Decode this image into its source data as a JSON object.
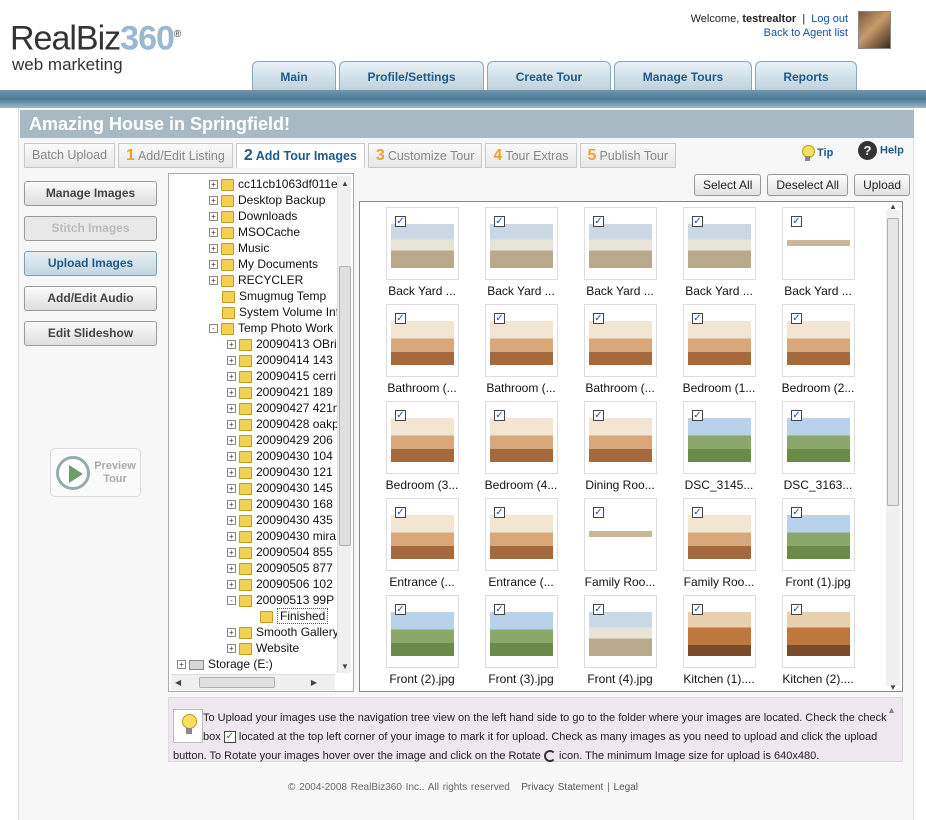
{
  "brand": {
    "name_main": "RealBiz",
    "name_num": "360",
    "reg": "®",
    "tagline": "web marketing"
  },
  "user": {
    "welcome_prefix": "Welcome, ",
    "username": "testrealtor",
    "separator": "|",
    "logout": "Log out",
    "back_to_agent_list": "Back to Agent list"
  },
  "nav_tabs": [
    "Main",
    "Profile/Settings",
    "Create Tour",
    "Manage Tours",
    "Reports"
  ],
  "tour_title": "Amazing House in Springfield!",
  "steps": [
    {
      "num": "",
      "label": "Batch Upload",
      "active": false
    },
    {
      "num": "1",
      "label": "Add/Edit Listing",
      "active": false
    },
    {
      "num": "2",
      "label": "Add Tour Images",
      "active": true
    },
    {
      "num": "3",
      "label": "Customize Tour",
      "active": false
    },
    {
      "num": "4",
      "label": "Tour Extras",
      "active": false
    },
    {
      "num": "5",
      "label": "Publish Tour",
      "active": false
    }
  ],
  "tip_label": "Tip",
  "help_label": "Help",
  "left_buttons": [
    {
      "label": "Manage Images",
      "state": "normal"
    },
    {
      "label": "Stitch Images",
      "state": "disabled"
    },
    {
      "label": "Upload Images",
      "state": "selected"
    },
    {
      "label": "Add/Edit Audio",
      "state": "normal"
    },
    {
      "label": "Edit Slideshow",
      "state": "normal"
    }
  ],
  "preview": {
    "line1": "Preview",
    "line2": "Tour"
  },
  "tree": [
    {
      "label": "cc11cb1063df011e",
      "level": 1,
      "expander": "+",
      "type": "folder"
    },
    {
      "label": "Desktop Backup",
      "level": 1,
      "expander": "+",
      "type": "folder"
    },
    {
      "label": "Downloads",
      "level": 1,
      "expander": "+",
      "type": "folder"
    },
    {
      "label": "MSOCache",
      "level": 1,
      "expander": "+",
      "type": "folder"
    },
    {
      "label": "Music",
      "level": 1,
      "expander": "+",
      "type": "folder"
    },
    {
      "label": "My Documents",
      "level": 1,
      "expander": "+",
      "type": "folder"
    },
    {
      "label": "RECYCLER",
      "level": 1,
      "expander": "+",
      "type": "folder"
    },
    {
      "label": "Smugmug Temp",
      "level": 1,
      "expander": "",
      "type": "folder"
    },
    {
      "label": "System Volume Info",
      "level": 1,
      "expander": "",
      "type": "folder"
    },
    {
      "label": "Temp Photo Work",
      "level": 1,
      "expander": "-",
      "type": "folder"
    },
    {
      "label": "20090413 OBri",
      "level": 2,
      "expander": "+",
      "type": "folder"
    },
    {
      "label": "20090414 143",
      "level": 2,
      "expander": "+",
      "type": "folder"
    },
    {
      "label": "20090415 cerri",
      "level": 2,
      "expander": "+",
      "type": "folder"
    },
    {
      "label": "20090421 189",
      "level": 2,
      "expander": "+",
      "type": "folder"
    },
    {
      "label": "20090427 421n",
      "level": 2,
      "expander": "+",
      "type": "folder"
    },
    {
      "label": "20090428 oakp",
      "level": 2,
      "expander": "+",
      "type": "folder"
    },
    {
      "label": "20090429 206",
      "level": 2,
      "expander": "+",
      "type": "folder"
    },
    {
      "label": "20090430 104",
      "level": 2,
      "expander": "+",
      "type": "folder"
    },
    {
      "label": "20090430 121",
      "level": 2,
      "expander": "+",
      "type": "folder"
    },
    {
      "label": "20090430 145",
      "level": 2,
      "expander": "+",
      "type": "folder"
    },
    {
      "label": "20090430 168",
      "level": 2,
      "expander": "+",
      "type": "folder"
    },
    {
      "label": "20090430 435",
      "level": 2,
      "expander": "+",
      "type": "folder"
    },
    {
      "label": "20090430 mira",
      "level": 2,
      "expander": "+",
      "type": "folder"
    },
    {
      "label": "20090504 855",
      "level": 2,
      "expander": "+",
      "type": "folder"
    },
    {
      "label": "20090505 877",
      "level": 2,
      "expander": "+",
      "type": "folder"
    },
    {
      "label": "20090506 102",
      "level": 2,
      "expander": "+",
      "type": "folder"
    },
    {
      "label": "20090513 99P",
      "level": 2,
      "expander": "-",
      "type": "folder"
    },
    {
      "label": "Finished",
      "level": 3,
      "expander": "",
      "type": "folder",
      "selected": true
    },
    {
      "label": "Smooth Gallery",
      "level": 2,
      "expander": "+",
      "type": "folder"
    },
    {
      "label": "Website",
      "level": 2,
      "expander": "+",
      "type": "folder"
    },
    {
      "label": "Storage (E:)",
      "level": 0,
      "expander": "+",
      "type": "drive"
    }
  ],
  "grid_buttons": [
    "Select All",
    "Deselect All",
    "Upload"
  ],
  "images": [
    {
      "caption": "Back Yard ...",
      "checked": true,
      "tone": "yard"
    },
    {
      "caption": "Back Yard ...",
      "checked": true,
      "tone": "yard"
    },
    {
      "caption": "Back Yard ...",
      "checked": true,
      "tone": "yard"
    },
    {
      "caption": "Back Yard ...",
      "checked": true,
      "tone": "yard"
    },
    {
      "caption": "Back Yard ...",
      "checked": true,
      "tone": "pano"
    },
    {
      "caption": "Bathroom (...",
      "checked": true,
      "tone": "warm"
    },
    {
      "caption": "Bathroom (...",
      "checked": true,
      "tone": "warm"
    },
    {
      "caption": "Bathroom (...",
      "checked": true,
      "tone": "warm"
    },
    {
      "caption": "Bedroom (1...",
      "checked": true,
      "tone": "warm"
    },
    {
      "caption": "Bedroom (2...",
      "checked": true,
      "tone": "warm"
    },
    {
      "caption": "Bedroom (3...",
      "checked": true,
      "tone": "warm"
    },
    {
      "caption": "Bedroom (4...",
      "checked": true,
      "tone": "warm"
    },
    {
      "caption": "Dining Roo...",
      "checked": true,
      "tone": "warm"
    },
    {
      "caption": "DSC_3145...",
      "checked": true,
      "tone": "outdoor"
    },
    {
      "caption": "DSC_3163...",
      "checked": true,
      "tone": "outdoor"
    },
    {
      "caption": "Entrance (...",
      "checked": true,
      "tone": "warm"
    },
    {
      "caption": "Entrance (...",
      "checked": true,
      "tone": "warm"
    },
    {
      "caption": "Family Roo...",
      "checked": true,
      "tone": "pano"
    },
    {
      "caption": "Family Roo...",
      "checked": true,
      "tone": "warm"
    },
    {
      "caption": "Front (1).jpg",
      "checked": true,
      "tone": "outdoor"
    },
    {
      "caption": "Front (2).jpg",
      "checked": true,
      "tone": "outdoor"
    },
    {
      "caption": "Front (3).jpg",
      "checked": true,
      "tone": "outdoor"
    },
    {
      "caption": "Front (4).jpg",
      "checked": true,
      "tone": "yard"
    },
    {
      "caption": "Kitchen (1)....",
      "checked": true,
      "tone": "kitchen"
    },
    {
      "caption": "Kitchen (2)....",
      "checked": true,
      "tone": "kitchen"
    }
  ],
  "instructions": {
    "part1": "To Upload your images use the navigation tree view on the left hand side to go to the folder where your images are located. Check the check box",
    "part2": "located at the top left corner of your image to mark it for upload. Check as many images as you need to upload and click the upload button. To Rotate your images hover over the image and click on the Rotate",
    "part3": "icon. The minimum Image size for upload is 640x480."
  },
  "footer": {
    "copyright": "© 2004-2008 RealBiz360 Inc.. All rights reserved",
    "privacy": "Privacy Statement",
    "sep": "|",
    "legal": "Legal"
  },
  "colors": {
    "title_bar": "#a9b9c3",
    "nav_text": "#1e5a8a",
    "step_number": "#f0a030",
    "instructions_bg": "#eee7f0"
  }
}
